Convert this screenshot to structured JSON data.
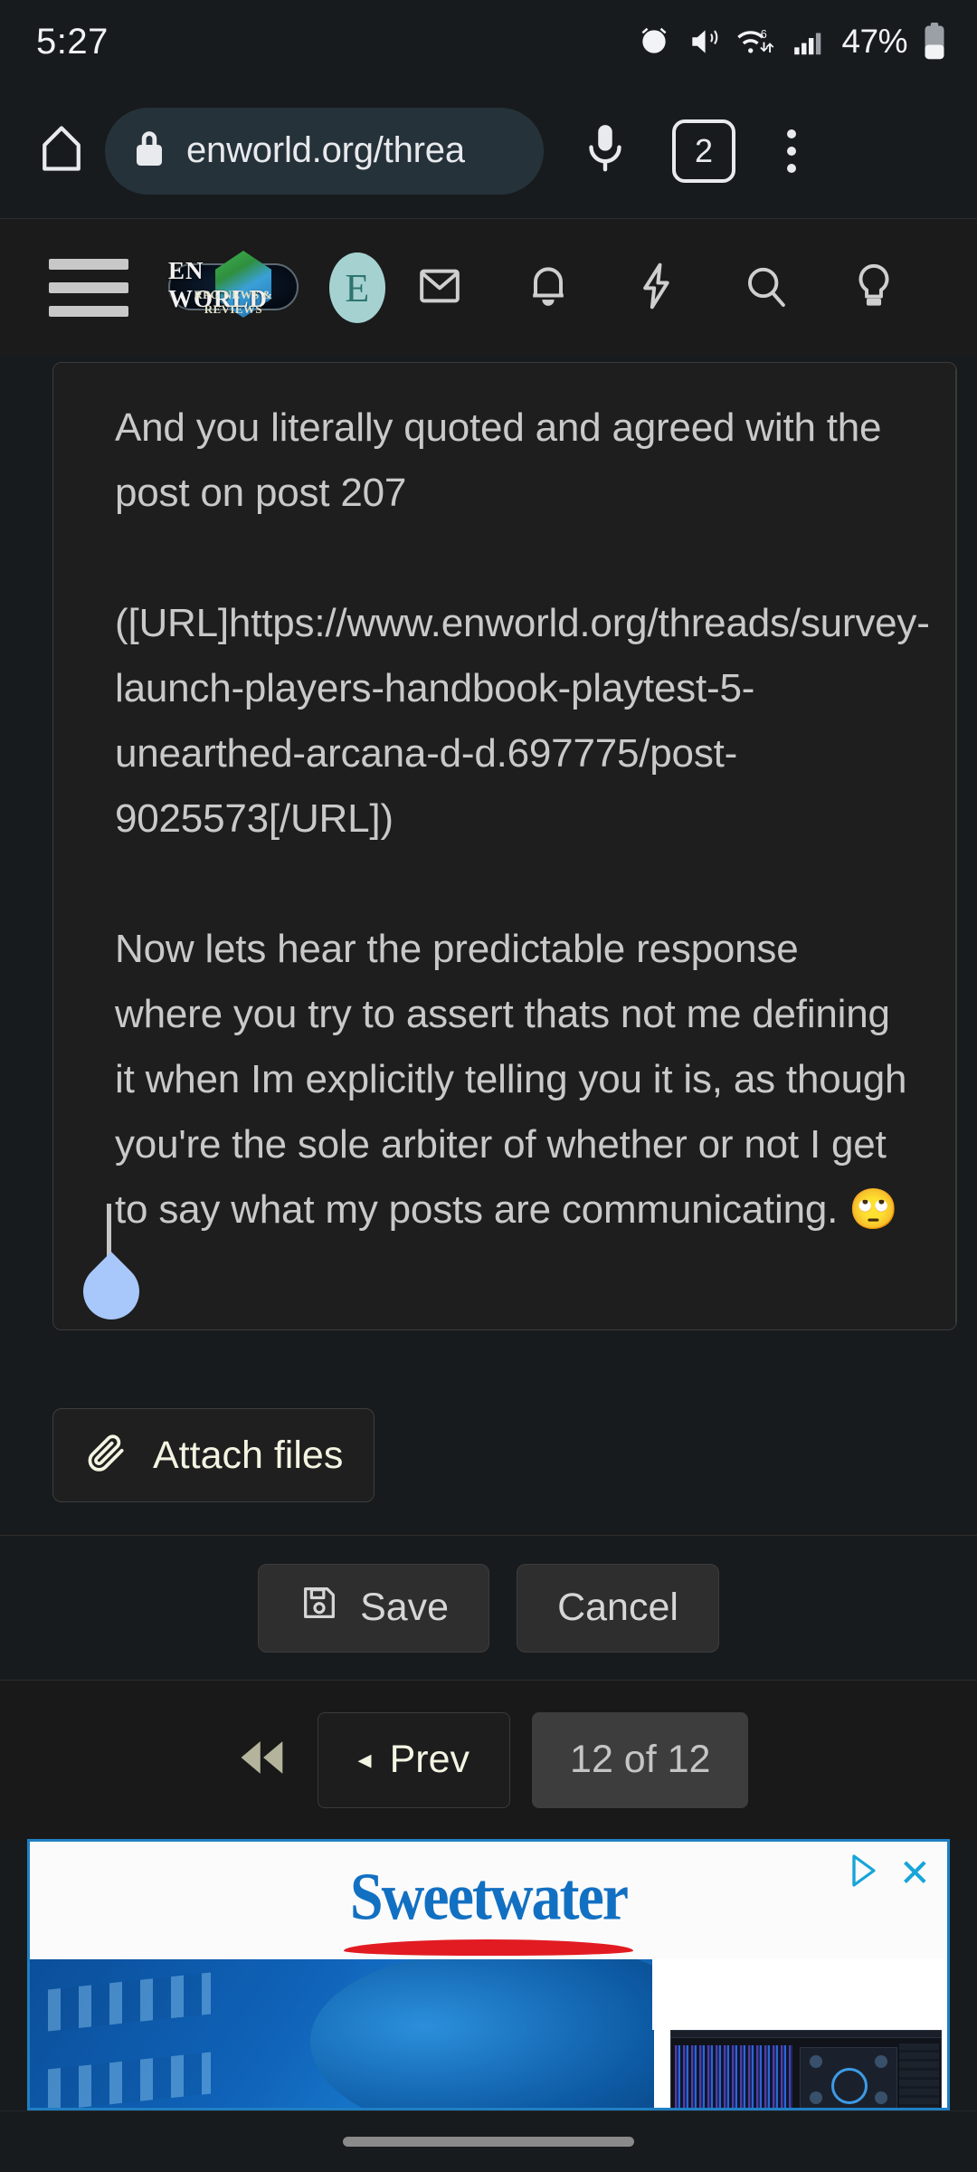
{
  "status_bar": {
    "time": "5:27",
    "battery_percent": "47%",
    "icons": [
      "alarm-icon",
      "vibrate-icon",
      "wifi-6-icon",
      "signal-bars-icon",
      "battery-icon"
    ]
  },
  "browser": {
    "home_icon": "home-icon",
    "lock_icon": "lock-icon",
    "url": "enworld.org/threa",
    "mic_icon": "microphone-icon",
    "tab_count": "2",
    "menu_icon": "overflow-menu-icon"
  },
  "site_nav": {
    "menu_icon": "hamburger-menu-icon",
    "logo_text": "EN WORLD",
    "logo_tagline": "RPG NEWS & REVIEWS",
    "avatar_initial": "E",
    "avatar_color": "#a5d2d0",
    "icons": [
      "mail-icon",
      "bell-icon",
      "lightning-bolt-icon",
      "search-icon",
      "lightbulb-icon"
    ]
  },
  "editor": {
    "paragraphs": [
      "And you literally quoted and agreed with the post on post 207",
      "([URL]https://www.enworld.org/threads/survey-launch-players-handbook-playtest-5-unearthed-arcana-d-d.697775/post-9025573[/URL])",
      "Now lets hear the predictable response where you try to assert thats not me defining it when Im explicitly telling you it is, as though you're the sole arbiter of whether or not I get to say what my posts are communicating. 🙄"
    ]
  },
  "attach": {
    "label": "Attach files",
    "icon": "paperclip-icon"
  },
  "actions": {
    "save_label": "Save",
    "save_icon": "floppy-disk-icon",
    "cancel_label": "Cancel"
  },
  "pagination": {
    "first_icon": "double-left-arrow-icon",
    "prev_label": "Prev",
    "prev_caret": "◂",
    "page_indicator": "12 of 12"
  },
  "ad": {
    "brand": "Sweetwater",
    "adchoices_icon": "adchoices-icon",
    "close_icon": "close-icon",
    "accent_blue": "#1270c2",
    "accent_red": "#e21b22",
    "border_color": "#1f7fc4"
  },
  "system_nav": {
    "gesture_pill": "home-gesture-pill"
  }
}
